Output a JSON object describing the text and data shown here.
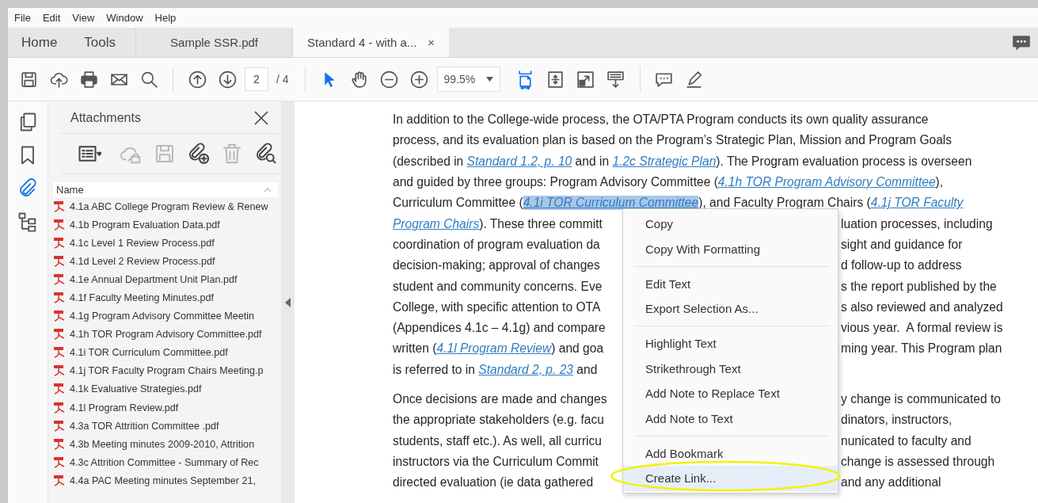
{
  "menu_bar": [
    "File",
    "Edit",
    "View",
    "Window",
    "Help"
  ],
  "tabs": [
    {
      "label": "Home",
      "kind": "nav",
      "selected": false
    },
    {
      "label": "Tools",
      "kind": "nav",
      "selected": false
    },
    {
      "label": "Sample SSR.pdf",
      "kind": "document",
      "selected": false
    },
    {
      "label": "Standard 4 - with a...",
      "kind": "document",
      "selected": true,
      "close": "×"
    }
  ],
  "toolbar": [
    {
      "kind": "save"
    },
    {
      "kind": "upload"
    },
    {
      "kind": "print"
    },
    {
      "kind": "mail"
    },
    {
      "kind": "search"
    },
    {
      "kind": "separator"
    },
    {
      "kind": "prev_page"
    },
    {
      "kind": "next_page"
    },
    {
      "kind": "page_field",
      "value": "2",
      "total": "/ 4"
    },
    {
      "kind": "separator"
    },
    {
      "kind": "select",
      "selected": true
    },
    {
      "kind": "hand",
      "selected": false
    },
    {
      "kind": "zoom_out"
    },
    {
      "kind": "zoom_in"
    },
    {
      "kind": "zoom_field",
      "value": "99.5%"
    },
    {
      "kind": "fit_width",
      "selected": true
    },
    {
      "kind": "fit_page",
      "selected": false
    },
    {
      "kind": "full_screen",
      "selected": false
    },
    {
      "kind": "scroll_mode",
      "selected": false
    },
    {
      "kind": "separator"
    },
    {
      "kind": "comment"
    },
    {
      "kind": "pen"
    }
  ],
  "left_rail": [
    {
      "kind": "pages",
      "selected": false
    },
    {
      "kind": "bookmarks",
      "selected": false
    },
    {
      "kind": "attachments",
      "selected": true
    },
    {
      "kind": "structure",
      "selected": false
    }
  ],
  "attachments_panel": {
    "title": "Attachments",
    "tools": [
      {
        "kind": "options",
        "disabled": false
      },
      {
        "kind": "cloud",
        "disabled": true
      },
      {
        "kind": "save",
        "disabled": true
      },
      {
        "kind": "add",
        "disabled": false
      },
      {
        "kind": "delete",
        "disabled": true
      },
      {
        "kind": "find",
        "disabled": false
      }
    ],
    "column": "Name",
    "files": [
      "4.1a ABC College Program Review & Renew",
      "4.1b Program Evaluation Data.pdf",
      "4.1c Level 1 Review Process.pdf",
      "4.1d Level 2 Review Process.pdf",
      "4.1e Annual Department Unit Plan.pdf",
      "4.1f Faculty Meeting Minutes.pdf",
      "4.1g Program Advisory Committee Meetin",
      "4.1h TOR Program Advisory Committee.pdf",
      "4.1i TOR Curriculum Committee.pdf",
      "4.1j TOR Faculty Program Chairs Meeting.p",
      "4.1k Evaluative Strategies.pdf",
      "4.1l Program Review.pdf",
      "4.3a TOR Attrition Committee .pdf",
      "4.3b Meeting minutes 2009-2010, Attrition",
      "4.3c Attrition Committee - Summary of Rec",
      "4.4a PAC Meeting minutes September 21,"
    ]
  },
  "document": {
    "paragraphs": [
      {
        "lines": [
          {
            "kind": "full",
            "left": [
              {
                "kind": "text",
                "text": "In addition to the College-wide process, the OTA/PTA Program conducts its own quality assurance"
              }
            ]
          },
          {
            "kind": "full",
            "left": [
              {
                "kind": "text",
                "text": "process, and its evaluation plan is based on the Program’s Strategic Plan, Mission and Program Goals"
              }
            ]
          },
          {
            "kind": "full",
            "left": [
              {
                "kind": "text",
                "text": "(described in "
              },
              {
                "kind": "link",
                "text": "Standard 1.2, p. 10"
              },
              {
                "kind": "text",
                "text": " and in "
              },
              {
                "kind": "link",
                "text": "1.2c Strategic Plan"
              },
              {
                "kind": "text",
                "text": "). The Program evaluation process is overseen"
              }
            ]
          },
          {
            "kind": "full",
            "left": [
              {
                "kind": "text",
                "text": "and guided by three groups: Program Advisory Committee ("
              },
              {
                "kind": "link",
                "text": "4.1h TOR Program Advisory Committee"
              },
              {
                "kind": "text",
                "text": "),"
              }
            ]
          },
          {
            "kind": "full",
            "left": [
              {
                "kind": "text",
                "text": "Curriculum Committee ("
              },
              {
                "kind": "selected_link",
                "text": "4.1i TOR Curriculum Committee"
              },
              {
                "kind": "text",
                "text": "), and Faculty Program Chairs ("
              },
              {
                "kind": "link",
                "text": "4.1j TOR Faculty"
              }
            ]
          },
          {
            "kind": "split",
            "left": [
              {
                "kind": "link",
                "text": "Program Chairs"
              },
              {
                "kind": "text",
                "text": "). These three committ"
              }
            ],
            "right": [
              {
                "kind": "text",
                "text": "luation processes, including"
              }
            ]
          },
          {
            "kind": "split",
            "left": [
              {
                "kind": "text",
                "text": "coordination of program evaluation da"
              }
            ],
            "right": [
              {
                "kind": "text",
                "text": "sight and guidance for"
              }
            ]
          },
          {
            "kind": "split",
            "left": [
              {
                "kind": "text",
                "text": "decision-making; approval of changes"
              }
            ],
            "right": [
              {
                "kind": "text",
                "text": "d follow-up to address"
              }
            ]
          },
          {
            "kind": "split",
            "left": [
              {
                "kind": "text",
                "text": "student and community concerns. Eve"
              }
            ],
            "right": [
              {
                "kind": "text",
                "text": "s the report published by the"
              }
            ]
          },
          {
            "kind": "split",
            "left": [
              {
                "kind": "text",
                "text": "College, with specific attention to OTA"
              }
            ],
            "right": [
              {
                "kind": "text",
                "text": "s also reviewed and analyzed"
              }
            ]
          },
          {
            "kind": "split",
            "left": [
              {
                "kind": "text",
                "text": "(Appendices 4.1c – 4.1g) and compare"
              }
            ],
            "right": [
              {
                "kind": "text",
                "text": "vious year.  A formal review is"
              }
            ]
          },
          {
            "kind": "split",
            "left": [
              {
                "kind": "text",
                "text": "written ("
              },
              {
                "kind": "link",
                "text": "4.1l Program Review"
              },
              {
                "kind": "text",
                "text": ") and goa"
              }
            ],
            "right": [
              {
                "kind": "text",
                "text": "ming year. This Program plan"
              }
            ]
          },
          {
            "kind": "split",
            "left": [
              {
                "kind": "text",
                "text": "is referred to in "
              },
              {
                "kind": "link",
                "text": "Standard 2, p. 23"
              },
              {
                "kind": "text",
                "text": " and"
              }
            ]
          }
        ]
      },
      {
        "lines": [
          {
            "kind": "split",
            "left": [
              {
                "kind": "text",
                "text": "Once decisions are made and changes"
              }
            ],
            "right": [
              {
                "kind": "text",
                "text": "y change is communicated to"
              }
            ]
          },
          {
            "kind": "split",
            "left": [
              {
                "kind": "text",
                "text": "the appropriate stakeholders (e.g. facu"
              }
            ],
            "right": [
              {
                "kind": "text",
                "text": "dinators, instructors,"
              }
            ]
          },
          {
            "kind": "split",
            "left": [
              {
                "kind": "text",
                "text": "students, staff etc.). As well, all curricu"
              }
            ],
            "right": [
              {
                "kind": "text",
                "text": "nunicated to faculty and"
              }
            ]
          },
          {
            "kind": "split",
            "left": [
              {
                "kind": "text",
                "text": "instructors via the Curriculum Commit"
              }
            ],
            "right": [
              {
                "kind": "text",
                "text": "change is assessed through"
              }
            ]
          },
          {
            "kind": "split",
            "left": [
              {
                "kind": "text",
                "text": "directed evaluation (ie data gathered"
              }
            ],
            "right": [
              {
                "kind": "text",
                "text": "and any additional"
              }
            ]
          }
        ]
      }
    ]
  },
  "context_menu": {
    "groups": [
      [
        {
          "label": "Copy",
          "selected": false
        },
        {
          "label": "Copy With Formatting",
          "selected": false
        }
      ],
      [
        {
          "label": "Edit Text",
          "selected": false
        },
        {
          "label": "Export Selection As...",
          "selected": false
        }
      ],
      [
        {
          "label": "Highlight Text",
          "selected": false
        },
        {
          "label": "Strikethrough Text",
          "selected": false
        },
        {
          "label": "Add Note to Replace Text",
          "selected": false
        },
        {
          "label": "Add Note to Text",
          "selected": false
        }
      ],
      [
        {
          "label": "Add Bookmark",
          "selected": false
        },
        {
          "label": "Create Link...",
          "selected": true
        }
      ]
    ],
    "circled": true
  }
}
